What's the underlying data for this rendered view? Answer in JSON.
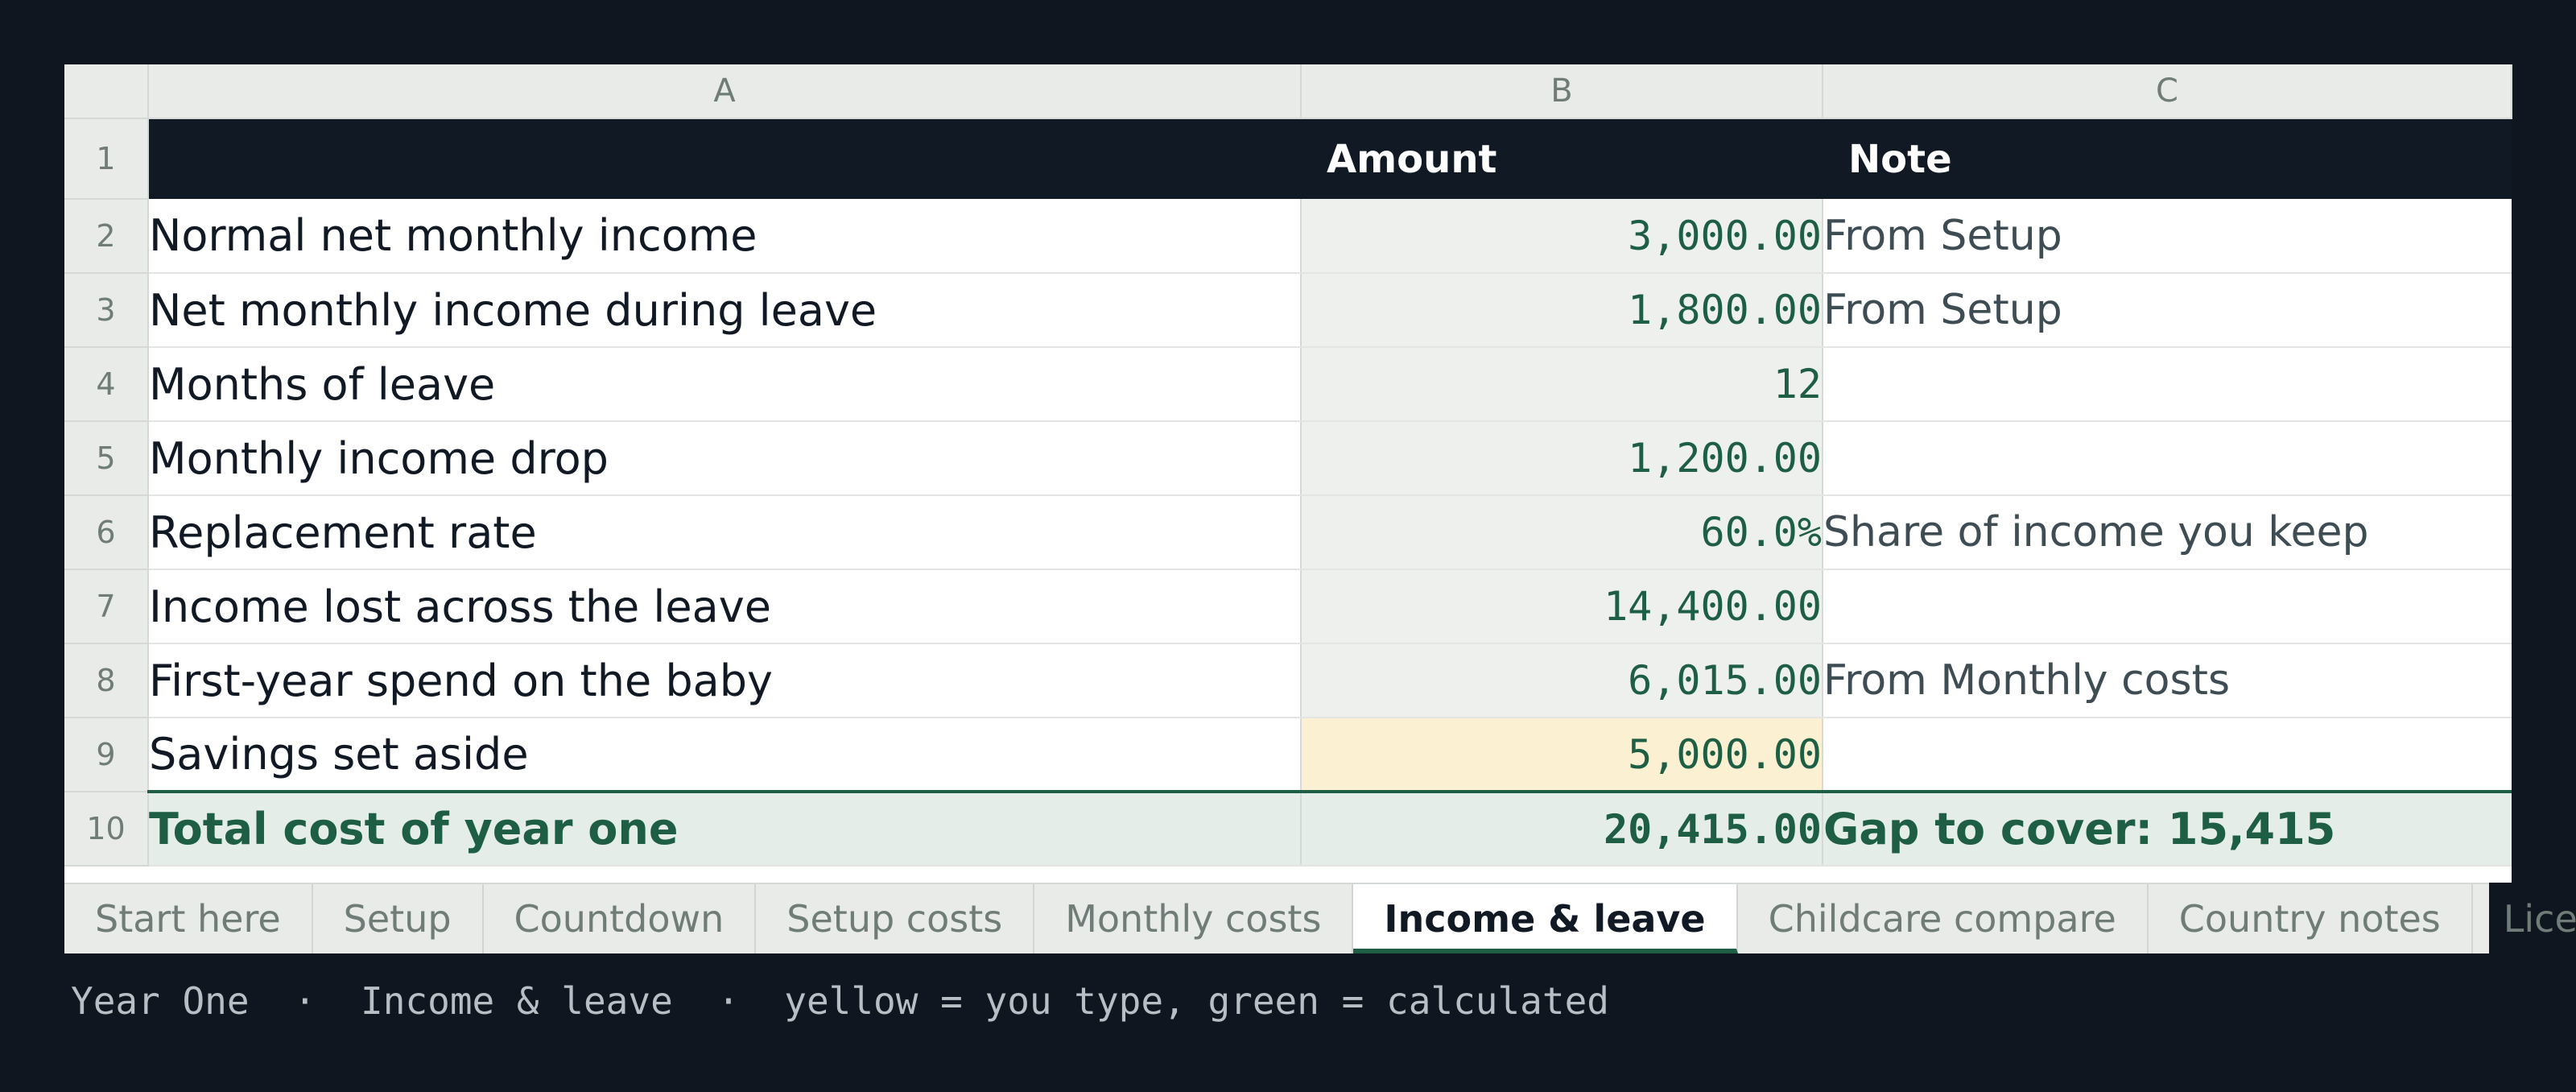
{
  "sheet": {
    "columns": [
      "A",
      "B",
      "C"
    ],
    "header_row": {
      "num": "1",
      "a": "",
      "b": "Amount",
      "c": "Note"
    },
    "rows": [
      {
        "num": "2",
        "label": "Normal net monthly income",
        "amount": "3,000.00",
        "note": "From Setup",
        "input": false
      },
      {
        "num": "3",
        "label": "Net monthly income during leave",
        "amount": "1,800.00",
        "note": "From Setup",
        "input": false
      },
      {
        "num": "4",
        "label": "Months of leave",
        "amount": "12",
        "note": "",
        "input": false
      },
      {
        "num": "5",
        "label": "Monthly income drop",
        "amount": "1,200.00",
        "note": "",
        "input": false
      },
      {
        "num": "6",
        "label": "Replacement rate",
        "amount": "60.0%",
        "note": "Share of income you keep",
        "input": false
      },
      {
        "num": "7",
        "label": "Income lost across the leave",
        "amount": "14,400.00",
        "note": "",
        "input": false
      },
      {
        "num": "8",
        "label": "First-year spend on the baby",
        "amount": "6,015.00",
        "note": "From Monthly costs",
        "input": false
      },
      {
        "num": "9",
        "label": "Savings set aside",
        "amount": "5,000.00",
        "note": "",
        "input": true
      }
    ],
    "total_row": {
      "num": "10",
      "label": "Total cost of year one",
      "amount": "20,415.00",
      "note": "Gap to cover: 15,415"
    }
  },
  "tabs": [
    {
      "label": "Start here",
      "active": false
    },
    {
      "label": "Setup",
      "active": false
    },
    {
      "label": "Countdown",
      "active": false
    },
    {
      "label": "Setup costs",
      "active": false
    },
    {
      "label": "Monthly costs",
      "active": false
    },
    {
      "label": "Income & leave",
      "active": true
    },
    {
      "label": "Childcare compare",
      "active": false
    },
    {
      "label": "Country notes",
      "active": false
    },
    {
      "label": "Licence",
      "active": false
    }
  ],
  "status": {
    "app": "Year One",
    "sep": "·",
    "sheet": "Income & leave",
    "hint": "yellow = you type, green = calculated"
  },
  "colors": {
    "background": "#10161f",
    "header": "#111a24",
    "calculated": "#1d5e45",
    "input_fill": "#fbf0d1",
    "total_fill": "#e4ede8"
  }
}
